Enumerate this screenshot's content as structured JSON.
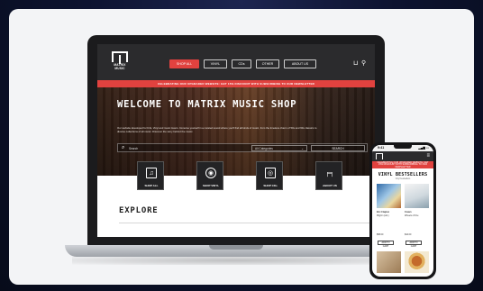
{
  "site": {
    "logo_text": "MATRIX MUSIC",
    "nav": [
      "SHOP ALL",
      "VINYL",
      "CDs",
      "OTHER",
      "ABOUT US"
    ],
    "cart_icon": "cart-icon",
    "user_icon": "user-icon",
    "promo": "CELEBRATING OUR UPGRADED WEBSITE: GET 15% DISCOUNT WITH SUBSCRIBING TO OUR NEWSLETTER",
    "hero_title": "WELCOME TO MATRIX MUSIC SHOP",
    "hero_desc": "Our website developed for DJs, Vinyl and music lovers. Immerse yourself in a curated sound where you'll find all kinds of music, from the timeless charm of 50s and 60s classics to diverse collections of all music. Discover the story behind the music.",
    "search_placeholder": "Search",
    "category_value": "All Categories",
    "search_button": "SEARCH",
    "tiles": [
      "SHOP ALL",
      "SHOP VINYL",
      "SHOP CDs",
      "ABOUT US"
    ],
    "explore_heading": "EXPLORE"
  },
  "phone": {
    "time": "9:41",
    "signal": "▂▄▆ ▭",
    "promo": "CELEBRATING OUR UPGRADED WEBSITE: GET 15% DISCOUNT WITH SUBSCRIBING TO OUR NEWSLETTER",
    "section_title": "VINYL BESTSELLERS",
    "section_sub": "Vinyl bestsellers",
    "item1_title": "Eric Clapton",
    "item1_sub": "Pilgrim (Ltd.)",
    "item1_price": "$58.00",
    "item2_title": "Cream",
    "item2_sub": "Wheels of Fire",
    "item2_price": "$44.00",
    "button_label": "ADD TO CART"
  },
  "colors": {
    "accent": "#e1423f",
    "header": "#2b2b2d",
    "background": "#0b1020"
  }
}
